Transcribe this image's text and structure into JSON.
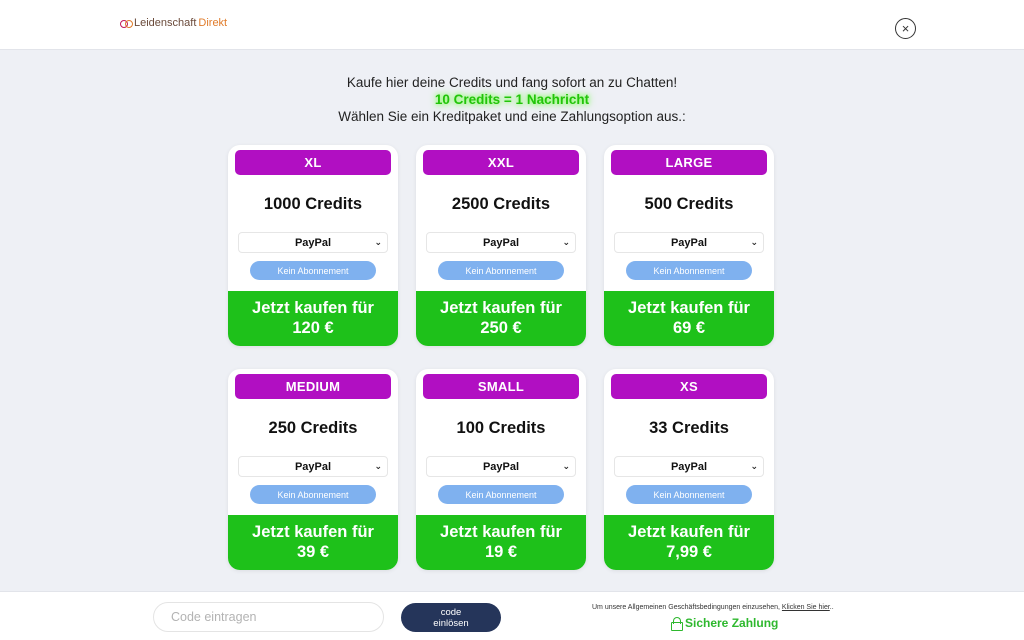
{
  "header": {
    "logo_part1": "Leidenschaft",
    "logo_part2": "Direkt",
    "close_symbol": "×"
  },
  "intro": {
    "line1": "Kaufe hier deine Credits und fang sofort an zu Chatten!",
    "highlight": "10 Credits = 1 Nachricht",
    "line2": "Wählen Sie ein Kreditpaket und eine Zahlungsoption aus.:"
  },
  "packages": [
    {
      "badge": "XL",
      "credits": "1000 Credits",
      "payment": "PayPal",
      "subscription": "Kein Abonnement",
      "buy_label": "Jetzt kaufen für",
      "price": "120 €"
    },
    {
      "badge": "XXL",
      "credits": "2500 Credits",
      "payment": "PayPal",
      "subscription": "Kein Abonnement",
      "buy_label": "Jetzt kaufen für",
      "price": "250 €"
    },
    {
      "badge": "LARGE",
      "credits": "500 Credits",
      "payment": "PayPal",
      "subscription": "Kein Abonnement",
      "buy_label": "Jetzt kaufen für",
      "price": "69 €"
    },
    {
      "badge": "MEDIUM",
      "credits": "250 Credits",
      "payment": "PayPal",
      "subscription": "Kein Abonnement",
      "buy_label": "Jetzt kaufen für",
      "price": "39 €"
    },
    {
      "badge": "SMALL",
      "credits": "100 Credits",
      "payment": "PayPal",
      "subscription": "Kein Abonnement",
      "buy_label": "Jetzt kaufen für",
      "price": "19 €"
    },
    {
      "badge": "XS",
      "credits": "33 Credits",
      "payment": "PayPal",
      "subscription": "Kein Abonnement",
      "buy_label": "Jetzt kaufen für",
      "price": "7,99 €"
    }
  ],
  "footer": {
    "code_placeholder": "Code eintragen",
    "code_button_line1": "code",
    "code_button_line2": "einlösen",
    "terms_text": "Um unsere Allgemeinen Geschäftsbedingungen einzusehen,",
    "terms_link": "Klicken Sie hier",
    "terms_end": "..",
    "secure_label": "Sichere Zahlung"
  },
  "colors": {
    "badge": "#b10fc2",
    "buy_button": "#1ec11a",
    "subscription_pill": "#7fb1ef",
    "code_button": "#25355a",
    "highlight": "#22c40a"
  },
  "icons": {
    "close": "close-icon",
    "chevron": "chevron-down-icon",
    "lock": "lock-icon",
    "logo": "logo-mark-icon"
  }
}
